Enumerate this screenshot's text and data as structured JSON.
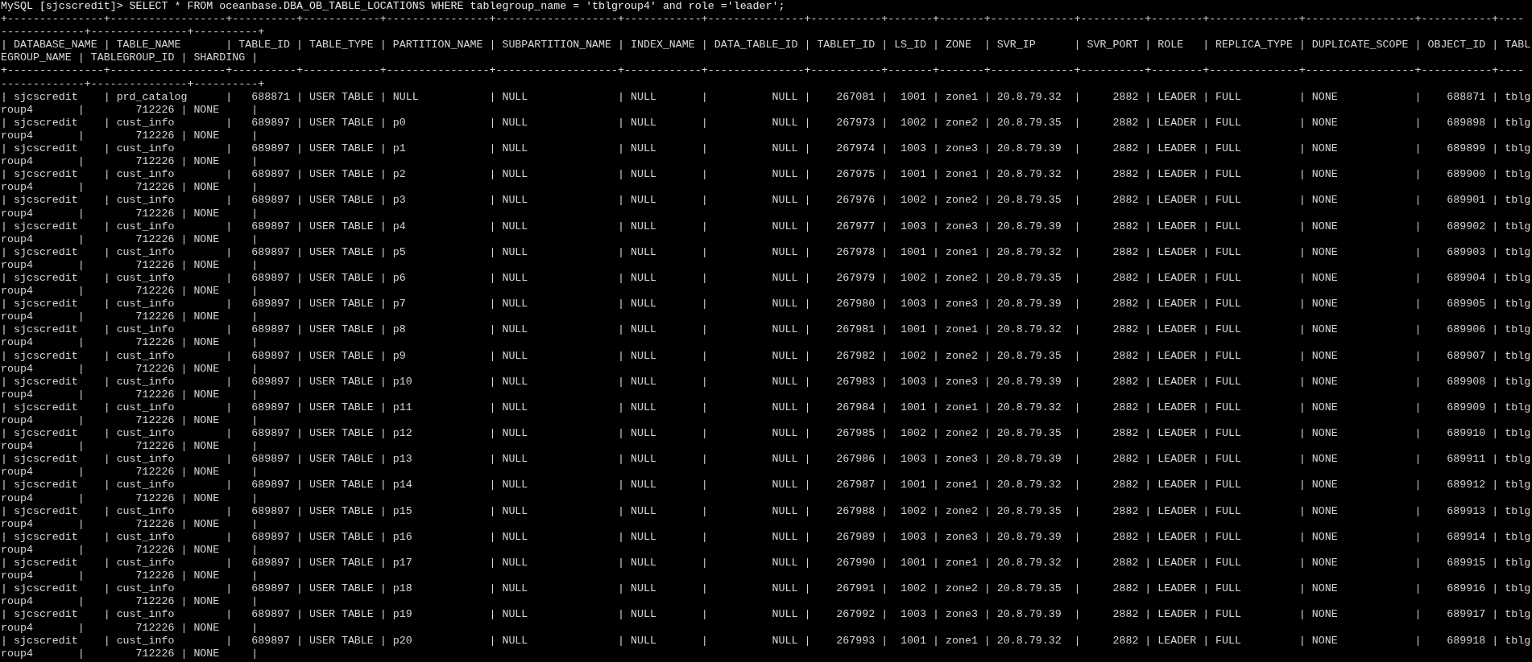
{
  "terminal": {
    "lines": [
      {
        "kind": "command",
        "text": "MySQL [sjcscredit]> SELECT * FROM oceanbase.DBA_OB_TABLE_LOCATIONS WHERE tablegroup_name = 'tblgroup4' and role ='leader';"
      },
      {
        "kind": "border",
        "text": "+---------------+------------------+----------+------------+----------------+-------------------+------------+---------------+-----------+-------+-------+-------------+----------+--------+--------------+-----------------+-----------+----"
      },
      {
        "kind": "border",
        "text": "-------------+---------------+----------+"
      },
      {
        "kind": "header",
        "text": "| DATABASE_NAME | TABLE_NAME       | TABLE_ID | TABLE_TYPE | PARTITION_NAME | SUBPARTITION_NAME | INDEX_NAME | DATA_TABLE_ID | TABLET_ID | LS_ID | ZONE  | SVR_IP      | SVR_PORT | ROLE   | REPLICA_TYPE | DUPLICATE_SCOPE | OBJECT_ID | TABL"
      },
      {
        "kind": "header",
        "text": "EGROUP_NAME | TABLEGROUP_ID | SHARDING |"
      },
      {
        "kind": "border",
        "text": "+---------------+------------------+----------+------------+----------------+-------------------+------------+---------------+-----------+-------+-------+-------------+----------+--------+--------------+-----------------+-----------+----"
      },
      {
        "kind": "border",
        "text": "-------------+---------------+----------+"
      },
      {
        "kind": "row",
        "text": "| sjcscredit    | prd_catalog      |   688871 | USER TABLE | NULL           | NULL              | NULL       |          NULL |    267081 |  1001 | zone1 | 20.8.79.32  |     2882 | LEADER | FULL         | NONE            |    688871 | tblg"
      },
      {
        "kind": "row",
        "text": "roup4       |        712226 | NONE     |"
      },
      {
        "kind": "row",
        "text": "| sjcscredit    | cust_info        |   689897 | USER TABLE | p0             | NULL              | NULL       |          NULL |    267973 |  1002 | zone2 | 20.8.79.35  |     2882 | LEADER | FULL         | NONE            |    689898 | tblg"
      },
      {
        "kind": "row",
        "text": "roup4       |        712226 | NONE     |"
      },
      {
        "kind": "row",
        "text": "| sjcscredit    | cust_info        |   689897 | USER TABLE | p1             | NULL              | NULL       |          NULL |    267974 |  1003 | zone3 | 20.8.79.39  |     2882 | LEADER | FULL         | NONE            |    689899 | tblg"
      },
      {
        "kind": "row",
        "text": "roup4       |        712226 | NONE     |"
      },
      {
        "kind": "row",
        "text": "| sjcscredit    | cust_info        |   689897 | USER TABLE | p2             | NULL              | NULL       |          NULL |    267975 |  1001 | zone1 | 20.8.79.32  |     2882 | LEADER | FULL         | NONE            |    689900 | tblg"
      },
      {
        "kind": "row",
        "text": "roup4       |        712226 | NONE     |"
      },
      {
        "kind": "row",
        "text": "| sjcscredit    | cust_info        |   689897 | USER TABLE | p3             | NULL              | NULL       |          NULL |    267976 |  1002 | zone2 | 20.8.79.35  |     2882 | LEADER | FULL         | NONE            |    689901 | tblg"
      },
      {
        "kind": "row",
        "text": "roup4       |        712226 | NONE     |"
      },
      {
        "kind": "row",
        "text": "| sjcscredit    | cust_info        |   689897 | USER TABLE | p4             | NULL              | NULL       |          NULL |    267977 |  1003 | zone3 | 20.8.79.39  |     2882 | LEADER | FULL         | NONE            |    689902 | tblg"
      },
      {
        "kind": "row",
        "text": "roup4       |        712226 | NONE     |"
      },
      {
        "kind": "row",
        "text": "| sjcscredit    | cust_info        |   689897 | USER TABLE | p5             | NULL              | NULL       |          NULL |    267978 |  1001 | zone1 | 20.8.79.32  |     2882 | LEADER | FULL         | NONE            |    689903 | tblg"
      },
      {
        "kind": "row",
        "text": "roup4       |        712226 | NONE     |"
      },
      {
        "kind": "row",
        "text": "| sjcscredit    | cust_info        |   689897 | USER TABLE | p6             | NULL              | NULL       |          NULL |    267979 |  1002 | zone2 | 20.8.79.35  |     2882 | LEADER | FULL         | NONE            |    689904 | tblg"
      },
      {
        "kind": "row",
        "text": "roup4       |        712226 | NONE     |"
      },
      {
        "kind": "row",
        "text": "| sjcscredit    | cust_info        |   689897 | USER TABLE | p7             | NULL              | NULL       |          NULL |    267980 |  1003 | zone3 | 20.8.79.39  |     2882 | LEADER | FULL         | NONE            |    689905 | tblg"
      },
      {
        "kind": "row",
        "text": "roup4       |        712226 | NONE     |"
      },
      {
        "kind": "row",
        "text": "| sjcscredit    | cust_info        |   689897 | USER TABLE | p8             | NULL              | NULL       |          NULL |    267981 |  1001 | zone1 | 20.8.79.32  |     2882 | LEADER | FULL         | NONE            |    689906 | tblg"
      },
      {
        "kind": "row",
        "text": "roup4       |        712226 | NONE     |"
      },
      {
        "kind": "row",
        "text": "| sjcscredit    | cust_info        |   689897 | USER TABLE | p9             | NULL              | NULL       |          NULL |    267982 |  1002 | zone2 | 20.8.79.35  |     2882 | LEADER | FULL         | NONE            |    689907 | tblg"
      },
      {
        "kind": "row",
        "text": "roup4       |        712226 | NONE     |"
      },
      {
        "kind": "row",
        "text": "| sjcscredit    | cust_info        |   689897 | USER TABLE | p10            | NULL              | NULL       |          NULL |    267983 |  1003 | zone3 | 20.8.79.39  |     2882 | LEADER | FULL         | NONE            |    689908 | tblg"
      },
      {
        "kind": "row",
        "text": "roup4       |        712226 | NONE     |"
      },
      {
        "kind": "row",
        "text": "| sjcscredit    | cust_info        |   689897 | USER TABLE | p11            | NULL              | NULL       |          NULL |    267984 |  1001 | zone1 | 20.8.79.32  |     2882 | LEADER | FULL         | NONE            |    689909 | tblg"
      },
      {
        "kind": "row",
        "text": "roup4       |        712226 | NONE     |"
      },
      {
        "kind": "row",
        "text": "| sjcscredit    | cust_info        |   689897 | USER TABLE | p12            | NULL              | NULL       |          NULL |    267985 |  1002 | zone2 | 20.8.79.35  |     2882 | LEADER | FULL         | NONE            |    689910 | tblg"
      },
      {
        "kind": "row",
        "text": "roup4       |        712226 | NONE     |"
      },
      {
        "kind": "row",
        "text": "| sjcscredit    | cust_info        |   689897 | USER TABLE | p13            | NULL              | NULL       |          NULL |    267986 |  1003 | zone3 | 20.8.79.39  |     2882 | LEADER | FULL         | NONE            |    689911 | tblg"
      },
      {
        "kind": "row",
        "text": "roup4       |        712226 | NONE     |"
      },
      {
        "kind": "row",
        "text": "| sjcscredit    | cust_info        |   689897 | USER TABLE | p14            | NULL              | NULL       |          NULL |    267987 |  1001 | zone1 | 20.8.79.32  |     2882 | LEADER | FULL         | NONE            |    689912 | tblg"
      },
      {
        "kind": "row",
        "text": "roup4       |        712226 | NONE     |"
      },
      {
        "kind": "row",
        "text": "| sjcscredit    | cust_info        |   689897 | USER TABLE | p15            | NULL              | NULL       |          NULL |    267988 |  1002 | zone2 | 20.8.79.35  |     2882 | LEADER | FULL         | NONE            |    689913 | tblg"
      },
      {
        "kind": "row",
        "text": "roup4       |        712226 | NONE     |"
      },
      {
        "kind": "row",
        "text": "| sjcscredit    | cust_info        |   689897 | USER TABLE | p16            | NULL              | NULL       |          NULL |    267989 |  1003 | zone3 | 20.8.79.39  |     2882 | LEADER | FULL         | NONE            |    689914 | tblg"
      },
      {
        "kind": "row",
        "text": "roup4       |        712226 | NONE     |"
      },
      {
        "kind": "row",
        "text": "| sjcscredit    | cust_info        |   689897 | USER TABLE | p17            | NULL              | NULL       |          NULL |    267990 |  1001 | zone1 | 20.8.79.32  |     2882 | LEADER | FULL         | NONE            |    689915 | tblg"
      },
      {
        "kind": "row",
        "text": "roup4       |        712226 | NONE     |"
      },
      {
        "kind": "row",
        "text": "| sjcscredit    | cust_info        |   689897 | USER TABLE | p18            | NULL              | NULL       |          NULL |    267991 |  1002 | zone2 | 20.8.79.35  |     2882 | LEADER | FULL         | NONE            |    689916 | tblg"
      },
      {
        "kind": "row",
        "text": "roup4       |        712226 | NONE     |"
      },
      {
        "kind": "row",
        "text": "| sjcscredit    | cust_info        |   689897 | USER TABLE | p19            | NULL              | NULL       |          NULL |    267992 |  1003 | zone3 | 20.8.79.39  |     2882 | LEADER | FULL         | NONE            |    689917 | tblg"
      },
      {
        "kind": "row",
        "text": "roup4       |        712226 | NONE     |"
      },
      {
        "kind": "row",
        "text": "| sjcscredit    | cust_info        |   689897 | USER TABLE | p20            | NULL              | NULL       |          NULL |    267993 |  1001 | zone1 | 20.8.79.32  |     2882 | LEADER | FULL         | NONE            |    689918 | tblg"
      },
      {
        "kind": "row",
        "text": "roup4       |        712226 | NONE     |"
      }
    ]
  }
}
